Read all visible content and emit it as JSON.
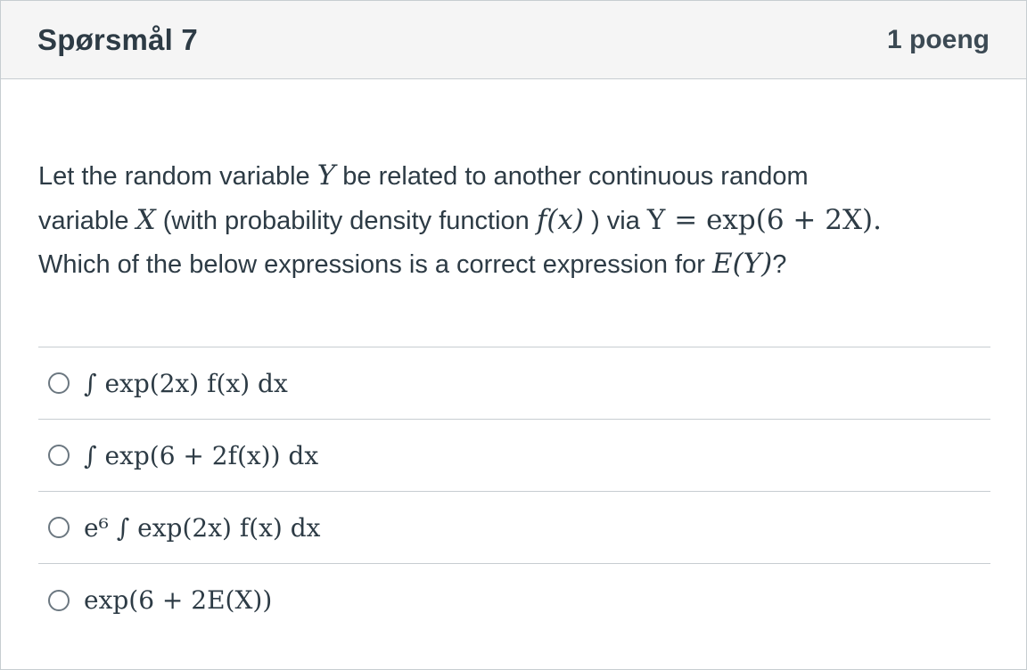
{
  "header": {
    "title": "Spørsmål 7",
    "points": "1 poeng"
  },
  "question": {
    "line1_a": "Let the random variable ",
    "var_Y": "Y",
    "line1_b": " be related to another continuous random",
    "line2_a": "variable ",
    "var_X": "X",
    "line2_b": " (with probability density function ",
    "fx": "f(x)",
    "line2_c": " ) via ",
    "relation": "Y = exp(6 + 2X)",
    "line2_d": ".",
    "line3_a": "Which of the below expressions is a correct expression for ",
    "expectation": "E(Y)",
    "line3_b": "?"
  },
  "answers": [
    {
      "label": "∫ exp(2x) f(x) dx"
    },
    {
      "label": "∫ exp(6 + 2f(x)) dx"
    },
    {
      "label": "e⁶ ∫ exp(2x) f(x) dx"
    },
    {
      "label": "exp(6 + 2E(X))"
    }
  ]
}
